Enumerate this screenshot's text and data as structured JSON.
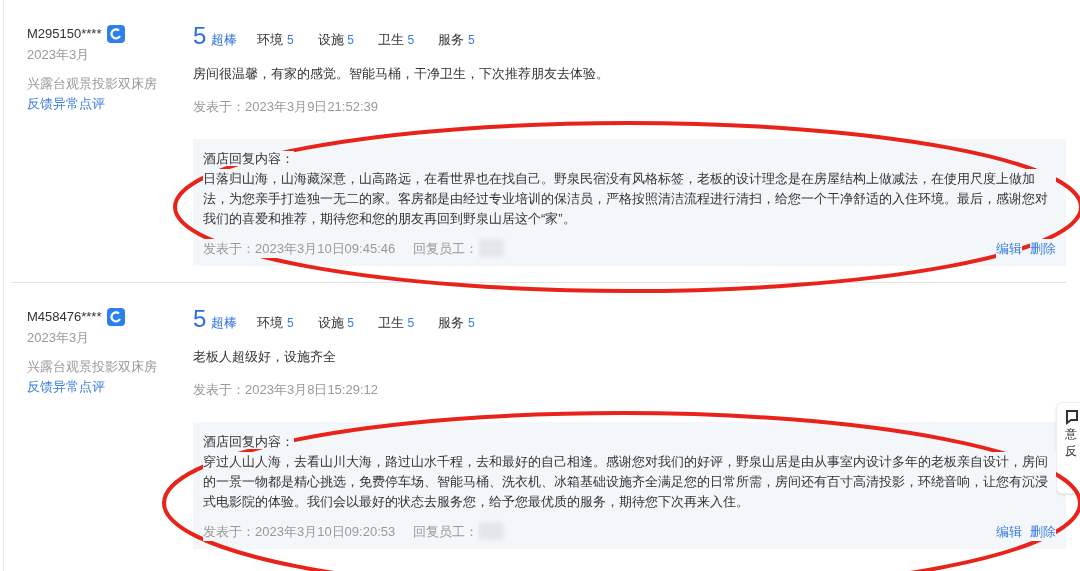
{
  "reviews": [
    {
      "user": "M295150****",
      "date": "2023年3月",
      "room": "兴露台观景投影双床房",
      "feedback_link": "反馈异常点评",
      "score": "5",
      "score_label": "超棒",
      "sub_scores": [
        {
          "label": "环境",
          "value": "5"
        },
        {
          "label": "设施",
          "value": "5"
        },
        {
          "label": "卫生",
          "value": "5"
        },
        {
          "label": "服务",
          "value": "5"
        }
      ],
      "text": "房间很温馨，有家的感觉。智能马桶，干净卫生，下次推荐朋友去体验。",
      "posted": "发表于：2023年3月9日21:52:39",
      "reply": {
        "title": "酒店回复内容：",
        "text": "日落归山海，山海藏深意，山高路远，在看世界也在找自己。野泉民宿没有风格标签，老板的设计理念是在房屋结构上做减法，在使用尺度上做加法，为您亲手打造独一无二的家。客房都是由经过专业培训的保洁员，严格按照清洁流程进行清扫，给您一个干净舒适的入住环境。最后，感谢您对我们的喜爱和推荐，期待您和您的朋友再回到野泉山居这个“家”。",
        "posted": "发表于：2023年3月10日09:45:46",
        "staff_label": "回复员工：",
        "actions": [
          "编辑",
          "删除"
        ]
      }
    },
    {
      "user": "M458476****",
      "date": "2023年3月",
      "room": "兴露台观景投影双床房",
      "feedback_link": "反馈异常点评",
      "score": "5",
      "score_label": "超棒",
      "sub_scores": [
        {
          "label": "环境",
          "value": "5"
        },
        {
          "label": "设施",
          "value": "5"
        },
        {
          "label": "卫生",
          "value": "5"
        },
        {
          "label": "服务",
          "value": "5"
        }
      ],
      "text": "老板人超级好，设施齐全",
      "posted": "发表于：2023年3月8日15:29:12",
      "reply": {
        "title": "酒店回复内容：",
        "text": "穿过人山人海，去看山川大海，路过山水千程，去和最好的自己相逢。感谢您对我们的好评，野泉山居是由从事室内设计多年的老板亲自设计，房间的一景一物都是精心挑选，免费停车场、智能马桶、洗衣机、冰箱基础设施齐全满足您的日常所需，房间还有百寸高清投影，环绕音响，让您有沉浸式电影院的体验。我们会以最好的状态去服务您，给予您最优质的服务，期待您下次再来入住。",
        "posted": "发表于：2023年3月10日09:20:53",
        "staff_label": "回复员工：",
        "actions": [
          "编辑",
          "删除"
        ]
      }
    }
  ],
  "side_widget": {
    "lines": [
      "意",
      "反"
    ]
  }
}
